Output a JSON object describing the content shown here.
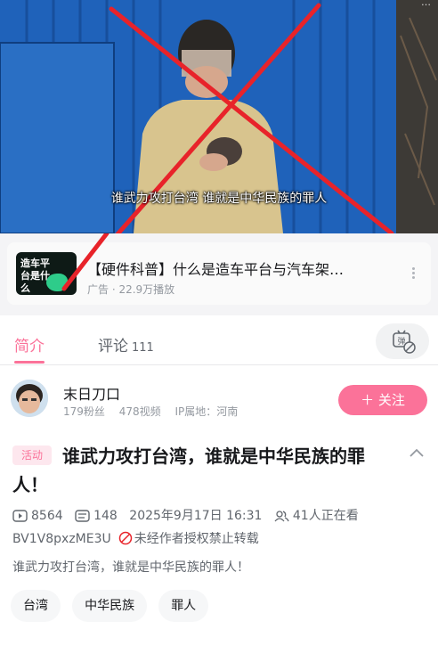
{
  "video": {
    "subtitle": "谁武力攻打台湾 谁就是中华民族的罪人",
    "corner_text": "…",
    "overlay_color": "#e8232a"
  },
  "ad": {
    "thumb_text": "造车平台是什么",
    "title": "【硬件科普】什么是造车平台与汽车架…",
    "meta": "广告 · 22.9万播放",
    "more_icon": "more-vertical-icon"
  },
  "tabs": {
    "intro_label": "简介",
    "comments_label": "评论",
    "comments_count": "111",
    "danmaku_icon": "danmaku-off-icon"
  },
  "uploader": {
    "name": "末日刀口",
    "fans": "179粉丝",
    "videos": "478视频",
    "ip": "IP属地：河南",
    "follow_label": "＋ 关注"
  },
  "info": {
    "badge": "活动",
    "title": "谁武力攻打台湾，谁就是中华民族的罪人！",
    "views": "8564",
    "danmaku": "148",
    "datetime": "2025年9月17日 16:31",
    "watching": "41人正在看",
    "bvid": "BV1V8pxzME3U",
    "copyright": "未经作者授权禁止转载",
    "description": "谁武力攻打台湾，谁就是中华民族的罪人！",
    "tags": [
      "台湾",
      "中华民族",
      "罪人"
    ]
  },
  "colors": {
    "accent": "#fb7299",
    "muted": "#9499a0",
    "secondary": "#61666d"
  }
}
